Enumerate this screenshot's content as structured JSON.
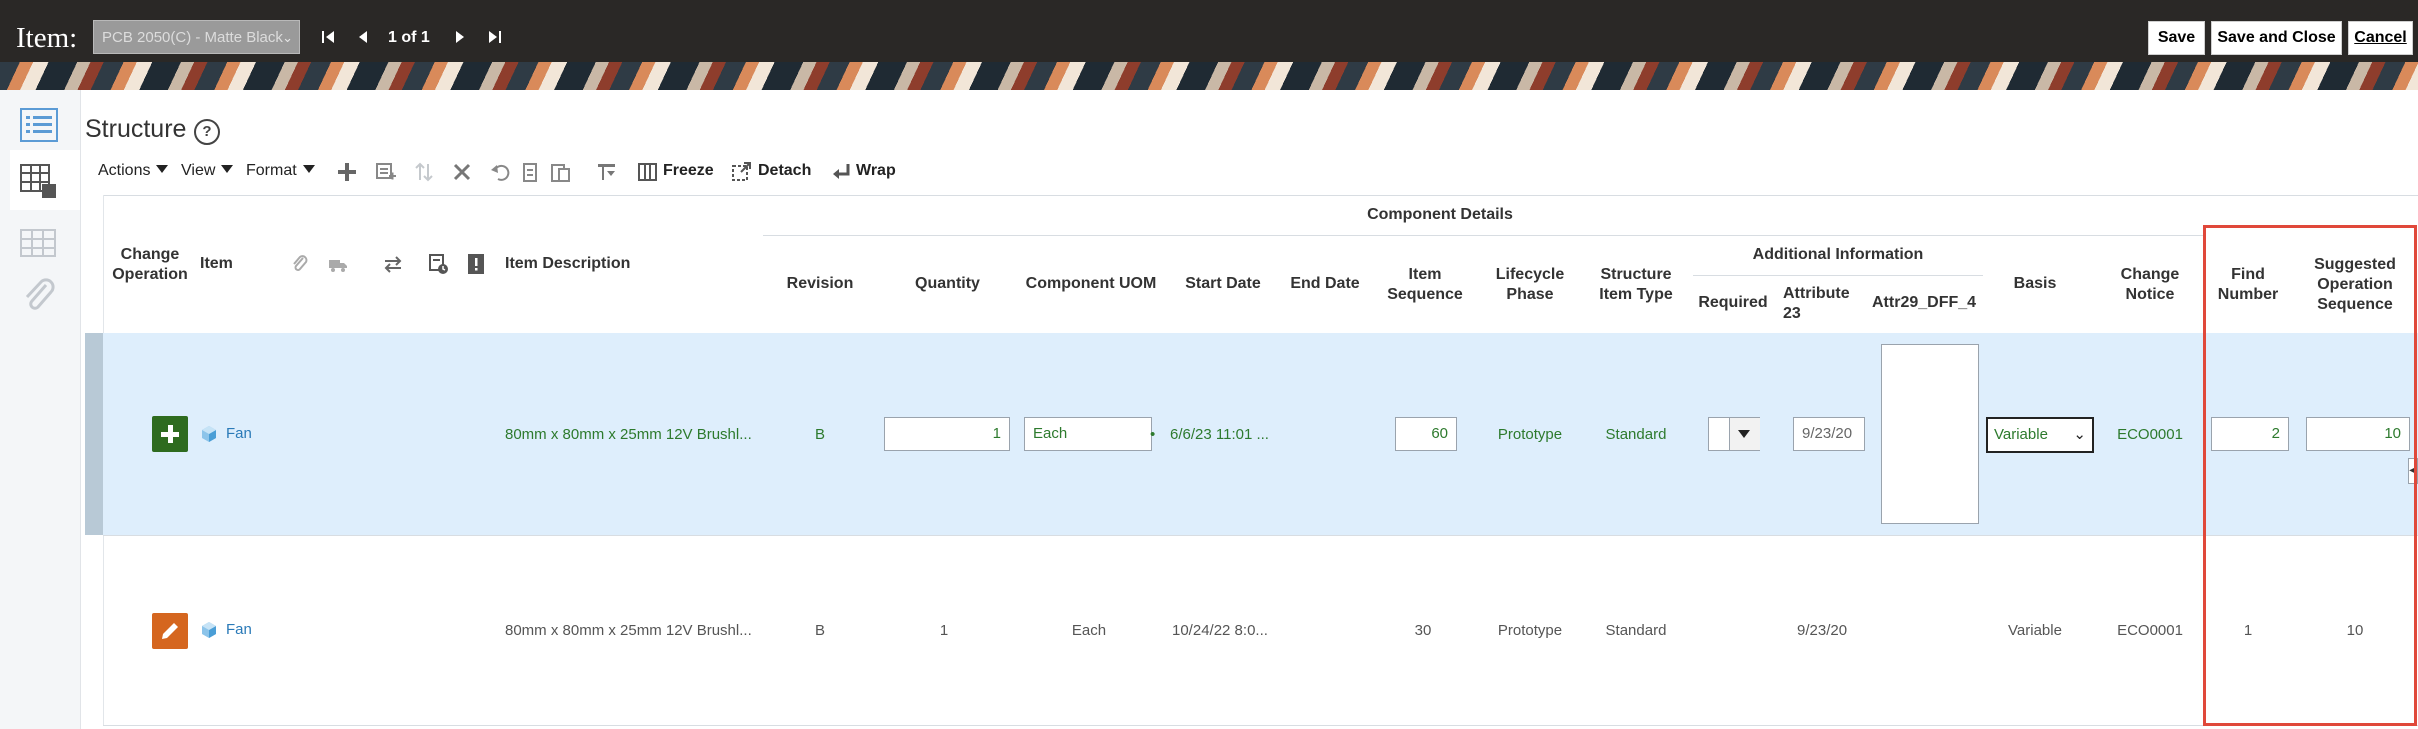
{
  "header": {
    "item_label": "Item:",
    "item_select_value": "PCB 2050(C) - Matte Black",
    "page_indicator": "1 of 1",
    "buttons": {
      "save": "Save",
      "save_and_close": "Save and Close",
      "cancel": "Cancel"
    }
  },
  "page": {
    "title": "Structure",
    "help": "?"
  },
  "toolbar": {
    "actions": "Actions",
    "view": "View",
    "format": "Format",
    "freeze": "Freeze",
    "detach": "Detach",
    "wrap": "Wrap"
  },
  "columns": {
    "change_operation": "Change Operation",
    "item": "Item",
    "item_description": "Item Description",
    "component_details": "Component Details",
    "revision": "Revision",
    "quantity": "Quantity",
    "component_uom": "Component UOM",
    "start_date": "Start Date",
    "end_date": "End Date",
    "item_sequence": "Item Sequence",
    "lifecycle_phase": "Lifecycle Phase",
    "structure_item_type": "Structure Item Type",
    "additional_information": "Additional Information",
    "required": "Required",
    "attribute_23": "Attribute 23",
    "attr29": "Attr29_DFF_4",
    "basis": "Basis",
    "change_notice": "Change Notice",
    "find_number": "Find Number",
    "suggested_operation_sequence": "Suggested Operation Sequence"
  },
  "rows": [
    {
      "item": "Fan",
      "description": "80mm x 80mm x 25mm 12V Brushl...",
      "revision": "B",
      "quantity": "1",
      "uom": "Each",
      "start_date": "6/6/23 11:01 ...",
      "end_date": "",
      "item_sequence": "60",
      "lifecycle_phase": "Prototype",
      "structure_item_type": "Standard",
      "attribute_23": "9/23/20",
      "basis": "Variable",
      "change_notice": "ECO0001",
      "find_number": "2",
      "suggested_operation_sequence": "10"
    },
    {
      "item": "Fan",
      "description": "80mm x 80mm x 25mm 12V Brushl...",
      "revision": "B",
      "quantity": "1",
      "uom": "Each",
      "start_date": "10/24/22 8:0...",
      "end_date": "",
      "item_sequence": "30",
      "lifecycle_phase": "Prototype",
      "structure_item_type": "Standard",
      "attribute_23": "9/23/20",
      "basis": "Variable",
      "change_notice": "ECO0001",
      "find_number": "1",
      "suggested_operation_sequence": "10"
    }
  ],
  "colors": {
    "topbar": "#2a2826",
    "add": "#2e6b1f",
    "edit": "#d5661f",
    "highlight": "#e0483a",
    "row_selected": "#deeefc"
  }
}
